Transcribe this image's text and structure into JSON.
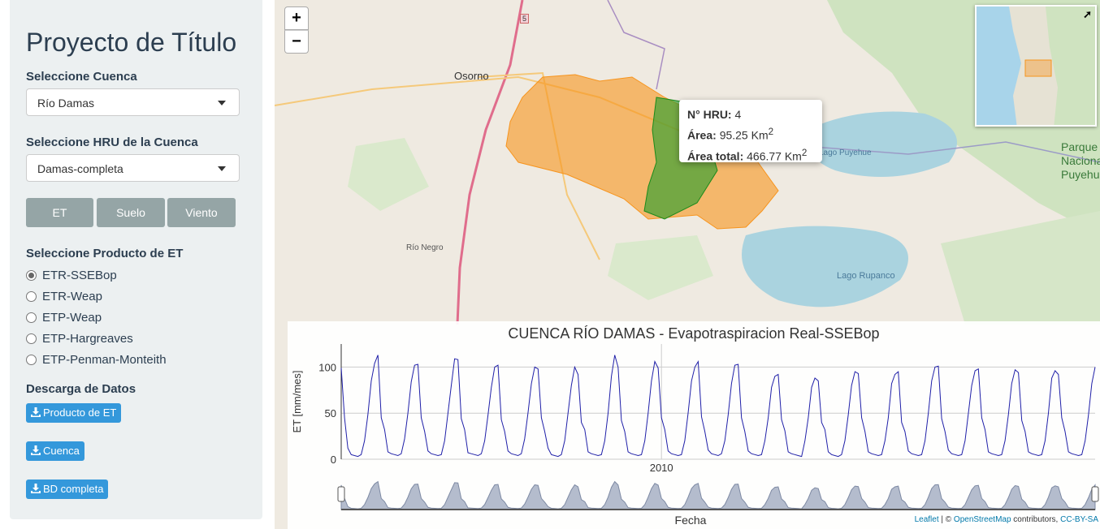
{
  "sidebar": {
    "title": "Proyecto de Título",
    "basin_label": "Seleccione Cuenca",
    "basin_value": "Río Damas",
    "hru_label": "Seleccione HRU de la Cuenca",
    "hru_value": "Damas-completa",
    "tabs": [
      "ET",
      "Suelo",
      "Viento"
    ],
    "product_label": "Seleccione Producto de ET",
    "products": [
      "ETR-SSEBop",
      "ETR-Weap",
      "ETP-Weap",
      "ETP-Hargreaves",
      "ETP-Penman-Monteith"
    ],
    "selected_product": "ETR-SSEBop",
    "download_label": "Descarga de Datos",
    "downloads": [
      "Producto de ET",
      "Cuenca",
      "BD completa"
    ]
  },
  "map": {
    "zoom_in": "+",
    "zoom_out": "−",
    "places": [
      "Osorno",
      "Río Negro",
      "Lago Puyehue",
      "Lago Rupanco",
      "Parque Nacional Puyehue",
      "5"
    ],
    "popup": {
      "hru_label": "N° HRU:",
      "hru_value": "4",
      "area_label": "Área:",
      "area_value": "95.25 Km",
      "total_label": "Área total:",
      "total_value": "466.77 Km",
      "exp": "2"
    },
    "attribution": {
      "leaflet": "Leaflet",
      "sep": " | © ",
      "osm": "OpenStreetMap",
      "contrib": " contributors, ",
      "license": "CC-BY-SA"
    },
    "colors": {
      "basin": "#f7941d",
      "hru": "#1a8a1a",
      "water": "#aad3df"
    }
  },
  "chart_data": {
    "type": "line",
    "title": "CUENCA RÍO DAMAS - Evapotraspiracion Real-SSEBop",
    "xlabel": "Fecha",
    "ylabel": "ET [mm/mes]",
    "x_tick_labels": [
      "2010"
    ],
    "ylim": [
      0,
      125
    ],
    "yticks": [
      0,
      50,
      100
    ],
    "series": [
      {
        "color": "#1f1fa8",
        "values": [
          99,
          45,
          12,
          5,
          4,
          3,
          5,
          20,
          48,
          85,
          104,
          113,
          45,
          32,
          8,
          6,
          5,
          4,
          6,
          22,
          50,
          84,
          102,
          103,
          45,
          30,
          9,
          6,
          5,
          4,
          5,
          20,
          50,
          80,
          109,
          108,
          44,
          32,
          7,
          6,
          5,
          4,
          6,
          20,
          48,
          78,
          100,
          102,
          43,
          30,
          9,
          6,
          5,
          4,
          6,
          22,
          50,
          82,
          100,
          98,
          45,
          30,
          12,
          5,
          4,
          3,
          5,
          20,
          50,
          80,
          100,
          92,
          40,
          32,
          8,
          6,
          5,
          4,
          5,
          20,
          50,
          90,
          113,
          100,
          42,
          30,
          8,
          6,
          5,
          4,
          5,
          20,
          50,
          85,
          106,
          99,
          45,
          32,
          9,
          6,
          5,
          4,
          5,
          20,
          50,
          85,
          100,
          106,
          46,
          30,
          10,
          6,
          5,
          4,
          6,
          20,
          48,
          82,
          102,
          103,
          45,
          30,
          9,
          6,
          5,
          4,
          5,
          20,
          45,
          78,
          90,
          92,
          43,
          31,
          8,
          6,
          5,
          4,
          3,
          20,
          45,
          78,
          88,
          85,
          40,
          32,
          8,
          5,
          4,
          3,
          5,
          20,
          48,
          80,
          95,
          93,
          45,
          30,
          8,
          6,
          5,
          4,
          5,
          20,
          45,
          82,
          92,
          95,
          40,
          30,
          9,
          6,
          5,
          4,
          5,
          20,
          50,
          85,
          100,
          101,
          44,
          30,
          10,
          6,
          5,
          4,
          5,
          20,
          50,
          80,
          96,
          98,
          45,
          32,
          8,
          6,
          5,
          4,
          5,
          20,
          48,
          82,
          97,
          94,
          42,
          30,
          8,
          6,
          5,
          4,
          5,
          20,
          50,
          88,
          96,
          92,
          45,
          30,
          8,
          6,
          5,
          4,
          5,
          20,
          48,
          82,
          100
        ]
      }
    ]
  }
}
